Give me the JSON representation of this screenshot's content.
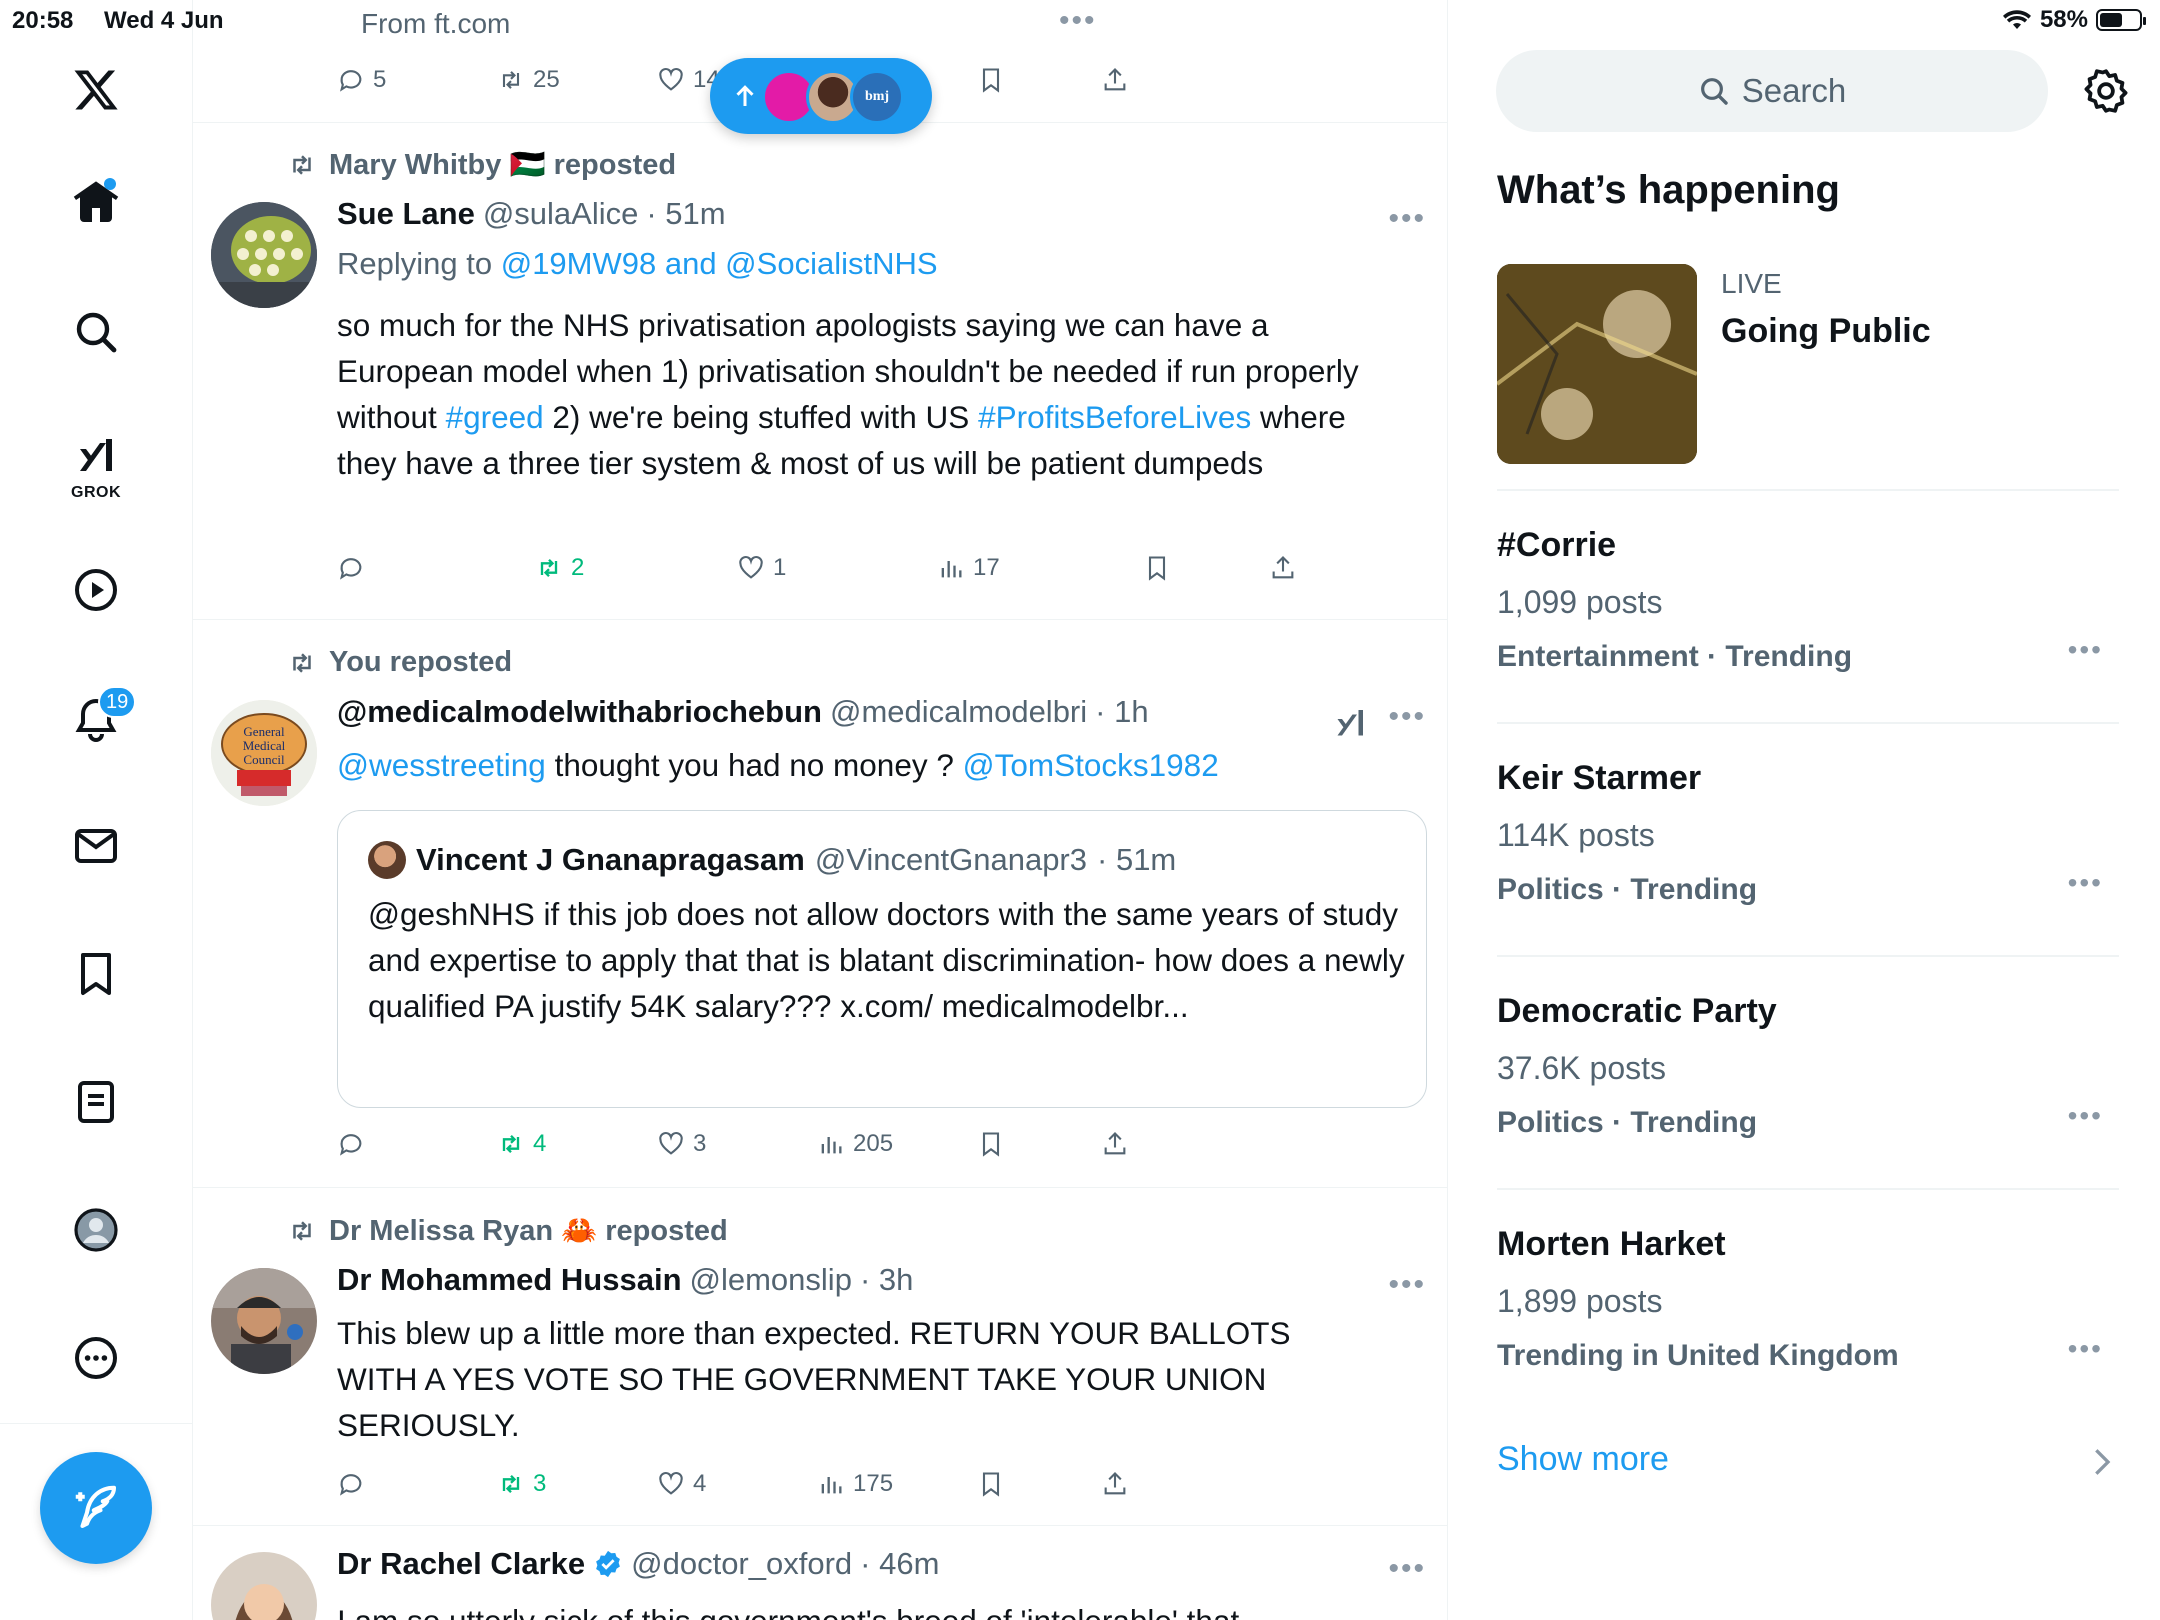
{
  "status_bar": {
    "time": "20:58",
    "date": "Wed 4 Jun",
    "battery": "58%",
    "battery_level": 0.58
  },
  "nav": {
    "items": [
      "home",
      "explore",
      "grok",
      "video",
      "notifications",
      "messages",
      "bookmarks",
      "lists",
      "profile",
      "more"
    ],
    "grok_label": "GROK",
    "notifications_badge": "19"
  },
  "timeline": {
    "top_post": {
      "from_link": "From ft.com",
      "replies": "5",
      "reposts": "25",
      "likes": "14"
    },
    "new_posts_pill": {
      "avatar_text": "bmj"
    },
    "posts": [
      {
        "repost_by": "Mary Whitby 🇵🇸 reposted",
        "name": "Sue Lane",
        "handle": "@sulaAlice",
        "time": "· 51m",
        "replying_prefix": "Replying to",
        "replying_handles": "@19MW98 and @SocialistNHS",
        "text": [
          "so much for the NHS privatisation apologists saying we can have a European model when 1) privatisation shouldn't be needed if run properly without ",
          "#greed",
          " 2) we're being stuffed with US ",
          "#ProfitsBeforeLives",
          " where they have a three tier system & most of us will be patient dumpeds"
        ],
        "reposts": "2",
        "likes": "1",
        "views": "17"
      },
      {
        "repost_by": "You reposted",
        "name": "@medicalmodelwithabriochebun",
        "handle": "@medicalmodelbri",
        "time": "· 1h",
        "text": [
          "@wesstreeting",
          " thought you had no money ? ",
          "@TomStocks1982"
        ],
        "quote": {
          "name": "Vincent J Gnanapragasam",
          "handle": "@VincentGnanapr3",
          "time": "· 51m",
          "text": "@geshNHS if this job does not allow doctors with the same years of study and expertise to apply that that is blatant discrimination- how does a newly qualified PA justify 54K salary??? x.com/ medicalmodelbr..."
        },
        "reposts": "4",
        "likes": "3",
        "views": "205"
      },
      {
        "repost_by": "Dr Melissa Ryan 🦀 reposted",
        "name": "Dr Mohammed Hussain",
        "handle": "@lemonslip",
        "time": "· 3h",
        "text": "This blew up a little more than expected. RETURN YOUR BALLOTS WITH A YES VOTE SO THE GOVERNMENT TAKE YOUR UNION SERIOUSLY.",
        "reposts": "3",
        "likes": "4",
        "views": "175"
      },
      {
        "name": "Dr Rachel Clarke",
        "handle": "@doctor_oxford",
        "time": "· 46m",
        "text": "I am so utterly sick of this government's breed of 'intolerable' that"
      }
    ]
  },
  "sidebar": {
    "search_placeholder": "Search",
    "whats_happening": "What’s happening",
    "live": {
      "label": "LIVE",
      "title": "Going Public"
    },
    "trends": [
      {
        "name": "#Corrie",
        "count": "1,099 posts",
        "category": "Entertainment · Trending"
      },
      {
        "name": "Keir Starmer",
        "count": "114K posts",
        "category": "Politics · Trending"
      },
      {
        "name": "Democratic Party",
        "count": "37.6K posts",
        "category": "Politics · Trending"
      },
      {
        "name": "Morten Harket",
        "count": "1,899 posts",
        "category": "Trending in United Kingdom"
      }
    ],
    "show_more": "Show more"
  },
  "colors": {
    "accent": "#1d9bf0",
    "repost_green": "#00ba7c",
    "muted": "#536471"
  }
}
